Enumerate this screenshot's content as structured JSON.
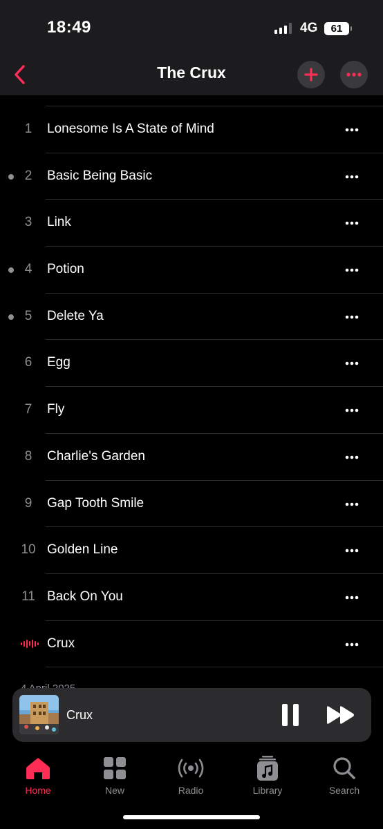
{
  "status_bar": {
    "time": "18:49",
    "network": "4G",
    "battery": "61"
  },
  "nav": {
    "title": "The Crux",
    "back_icon": "chevron-left-icon",
    "add_icon": "plus-icon",
    "more_icon": "ellipsis-icon"
  },
  "colors": {
    "accent": "#ff2d55",
    "background": "#000000",
    "bar": "#1c1c1e",
    "secondary_text": "#8e8e93"
  },
  "tracks": [
    {
      "number": "1",
      "title": "Lonesome Is A State of Mind",
      "downloaded": false
    },
    {
      "number": "2",
      "title": "Basic Being Basic",
      "downloaded": true
    },
    {
      "number": "3",
      "title": "Link",
      "downloaded": false
    },
    {
      "number": "4",
      "title": "Potion",
      "downloaded": true
    },
    {
      "number": "5",
      "title": "Delete Ya",
      "downloaded": true
    },
    {
      "number": "6",
      "title": "Egg",
      "downloaded": false
    },
    {
      "number": "7",
      "title": "Fly",
      "downloaded": false
    },
    {
      "number": "8",
      "title": "Charlie's Garden",
      "downloaded": false
    },
    {
      "number": "9",
      "title": "Gap Tooth Smile",
      "downloaded": false
    },
    {
      "number": "10",
      "title": "Golden Line",
      "downloaded": false
    },
    {
      "number": "11",
      "title": "Back On You",
      "downloaded": false
    },
    {
      "number": "",
      "title": "Crux",
      "downloaded": false,
      "now_playing": true
    }
  ],
  "release_date_partial": "4 April 2025",
  "mini_player": {
    "title": "Crux",
    "state": "playing"
  },
  "tab_bar": [
    {
      "label": "Home",
      "icon": "home-icon",
      "active": true
    },
    {
      "label": "New",
      "icon": "grid-icon",
      "active": false
    },
    {
      "label": "Radio",
      "icon": "radio-icon",
      "active": false
    },
    {
      "label": "Library",
      "icon": "library-icon",
      "active": false
    },
    {
      "label": "Search",
      "icon": "search-icon",
      "active": false
    }
  ]
}
